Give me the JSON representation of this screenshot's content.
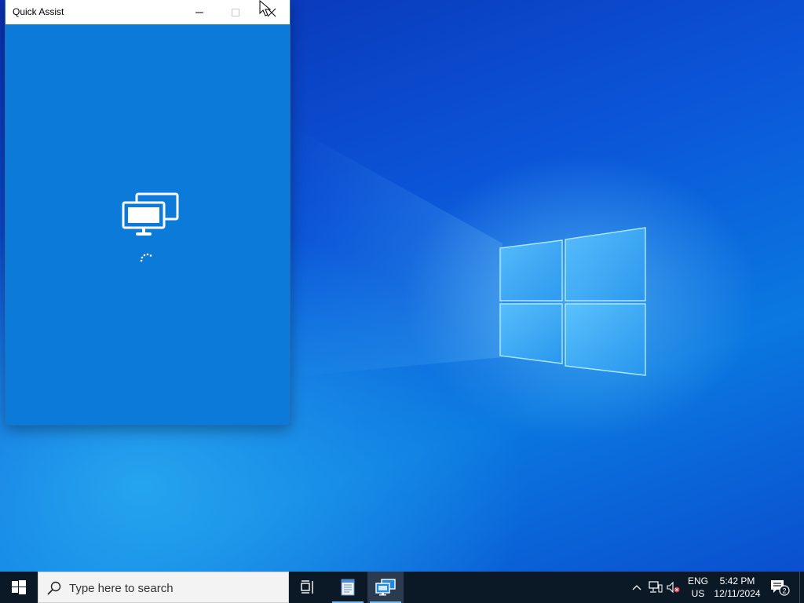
{
  "quick_assist": {
    "title": "Quick Assist",
    "icons": {
      "minimize": "minimize-icon",
      "maximize": "maximize-icon",
      "close": "close-icon",
      "monitor": "remote-monitor-icon",
      "spinner": "loading-spinner-icon"
    }
  },
  "taskbar": {
    "search_placeholder": "Type here to search",
    "apps": [
      {
        "name": "Task View",
        "icon": "task-view-icon"
      },
      {
        "name": "Notepad",
        "icon": "notepad-icon"
      },
      {
        "name": "Quick Assist",
        "icon": "quick-assist-icon",
        "active": true
      }
    ],
    "tray": {
      "lang_line1": "ENG",
      "lang_line2": "US",
      "time": "5:42 PM",
      "date": "12/11/2024",
      "notification_count": "2"
    }
  },
  "colors": {
    "window_bg": "#0b7ad8",
    "taskbar_bg": "#0b1826",
    "accent": "#76b9ed"
  }
}
